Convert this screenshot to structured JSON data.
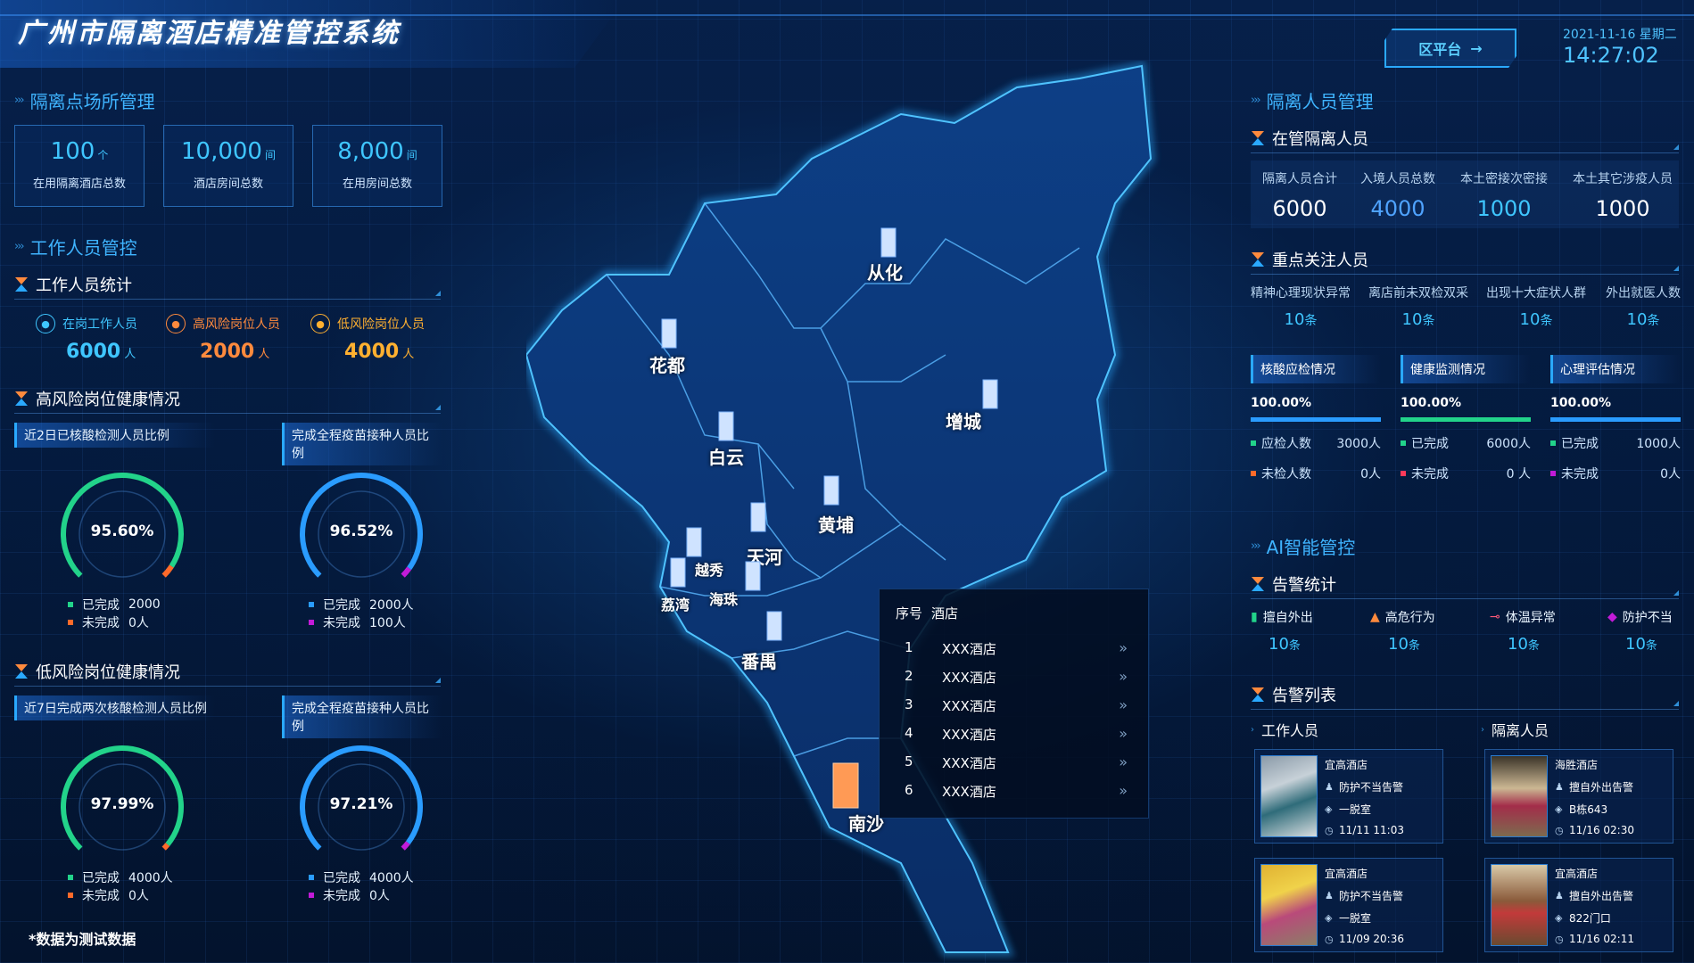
{
  "header": {
    "title": "广州市隔离酒店精准管控系统",
    "platform_button": "区平台",
    "date": "2021-11-16 星期二",
    "time": "14:27:02"
  },
  "left": {
    "venue_section": "隔离点场所管理",
    "venue_stats": [
      {
        "value": "100",
        "unit": "个",
        "label": "在用隔离酒店总数"
      },
      {
        "value": "10,000",
        "unit": "间",
        "label": "酒店房间总数"
      },
      {
        "value": "8,000",
        "unit": "间",
        "label": "在用房间总数"
      }
    ],
    "staff_section": "工作人员管控",
    "staff_stats_title": "工作人员统计",
    "staff_stats": [
      {
        "label": "在岗工作人员",
        "value": "6000",
        "unit": "人",
        "color": "#3fc6ff"
      },
      {
        "label": "高风险岗位人员",
        "value": "2000",
        "unit": "人",
        "color": "#ff8a3d"
      },
      {
        "label": "低风险岗位人员",
        "value": "4000",
        "unit": "人",
        "color": "#ffb030"
      }
    ],
    "high_risk_title": "高风险岗位健康情况",
    "high_risk": [
      {
        "tab": "近2日已核酸检测人员比例",
        "pct": "95.60%",
        "fraction": 0.956,
        "done_label": "已完成",
        "done": "2000",
        "todo_label": "未完成",
        "todo": "0人",
        "color": "#22d38a",
        "tail": "#ff6a2a"
      },
      {
        "tab": "完成全程疫苗接种人员比例",
        "pct": "96.52%",
        "fraction": 0.9652,
        "done_label": "已完成",
        "done": "2000人",
        "todo_label": "未完成",
        "todo": "100人",
        "color": "#2a9cff",
        "tail": "#c21bd8"
      }
    ],
    "low_risk_title": "低风险岗位健康情况",
    "low_risk": [
      {
        "tab": "近7日完成两次核酸检测人员比例",
        "pct": "97.99%",
        "fraction": 0.9799,
        "done_label": "已完成",
        "done": "4000人",
        "todo_label": "未完成",
        "todo": "0人",
        "color": "#22d38a",
        "tail": "#ff6a2a"
      },
      {
        "tab": "完成全程疫苗接种人员比例",
        "pct": "97.21%",
        "fraction": 0.9721,
        "done_label": "已完成",
        "done": "4000人",
        "todo_label": "未完成",
        "todo": "0人",
        "color": "#2a9cff",
        "tail": "#c21bd8"
      }
    ],
    "footnote": "*数据为测试数据"
  },
  "map": {
    "districts": [
      "从化",
      "花都",
      "增城",
      "白云",
      "黄埔",
      "天河",
      "越秀",
      "荔湾",
      "海珠",
      "番禺",
      "南沙"
    ],
    "table": {
      "col_no": "序号",
      "col_name": "酒店",
      "rows": [
        {
          "no": "1",
          "name": "XXX酒店"
        },
        {
          "no": "2",
          "name": "XXX酒店"
        },
        {
          "no": "3",
          "name": "XXX酒店"
        },
        {
          "no": "4",
          "name": "XXX酒店"
        },
        {
          "no": "5",
          "name": "XXX酒店"
        },
        {
          "no": "6",
          "name": "XXX酒店"
        }
      ],
      "arrow": "»"
    }
  },
  "right": {
    "person_section": "隔离人员管理",
    "in_custody_title": "在管隔离人员",
    "in_custody": [
      {
        "label": "隔离人员合计",
        "value": "6000",
        "color": "#ffffff"
      },
      {
        "label": "入境人员总数",
        "value": "4000",
        "color": "#4fa3ff"
      },
      {
        "label": "本土密接次密接",
        "value": "1000",
        "color": "#3fc6ff"
      },
      {
        "label": "本土其它涉疫人员",
        "value": "1000",
        "color": "#ffffff"
      }
    ],
    "focus_title": "重点关注人员",
    "focus": [
      {
        "label": "精神心理现状异常",
        "value": "10",
        "unit": "条"
      },
      {
        "label": "离店前未双检双采",
        "value": "10",
        "unit": "条"
      },
      {
        "label": "出现十大症状人群",
        "value": "10",
        "unit": "条"
      },
      {
        "label": "外出就医人数",
        "value": "10",
        "unit": "条"
      }
    ],
    "checks": [
      {
        "title": "核酸应检情况",
        "pct": "100.00%",
        "fraction": 1.0,
        "bar": "#2a9cff",
        "rows": [
          {
            "label": "应检人数",
            "value": "3000人",
            "color": "#22d38a"
          },
          {
            "label": "未检人数",
            "value": "0人",
            "color": "#ff6a2a"
          }
        ]
      },
      {
        "title": "健康监测情况",
        "pct": "100.00%",
        "fraction": 1.0,
        "bar": "#22d38a",
        "rows": [
          {
            "label": "已完成",
            "value": "6000人",
            "color": "#22d38a"
          },
          {
            "label": "未完成",
            "value": "0 人",
            "color": "#ff3a5a"
          }
        ]
      },
      {
        "title": "心理评估情况",
        "pct": "100.00%",
        "fraction": 1.0,
        "bar": "#2a9cff",
        "rows": [
          {
            "label": "已完成",
            "value": "1000人",
            "color": "#22d38a"
          },
          {
            "label": "未完成",
            "value": "0人",
            "color": "#c21bd8"
          }
        ]
      }
    ],
    "ai_section": "AI智能管控",
    "alarm_stats_title": "告警统计",
    "alarm_stats": [
      {
        "label": "擅自外出",
        "value": "10",
        "unit": "条",
        "icon": "door-icon",
        "color": "#22d38a"
      },
      {
        "label": "高危行为",
        "value": "10",
        "unit": "条",
        "icon": "warning-icon",
        "color": "#ff8a3d"
      },
      {
        "label": "体温异常",
        "value": "10",
        "unit": "条",
        "icon": "thermometer-icon",
        "color": "#ff5a7a"
      },
      {
        "label": "防护不当",
        "value": "10",
        "unit": "条",
        "icon": "shield-icon",
        "color": "#c21bd8"
      }
    ],
    "alarm_list_title": "告警列表",
    "list_staff": "工作人员",
    "list_isolated": "隔离人员",
    "alarms": [
      {
        "hotel": "宜高酒店",
        "type": "防护不当告警",
        "loc": "一脱室",
        "time": "11/11 11:03"
      },
      {
        "hotel": "海胜酒店",
        "type": "擅自外出告警",
        "loc": "B栋643",
        "time": "11/16 02:30"
      },
      {
        "hotel": "宜高酒店",
        "type": "防护不当告警",
        "loc": "一脱室",
        "time": "11/09 20:36"
      },
      {
        "hotel": "宜高酒店",
        "type": "擅自外出告警",
        "loc": "822门口",
        "time": "11/16 02:11"
      }
    ]
  }
}
